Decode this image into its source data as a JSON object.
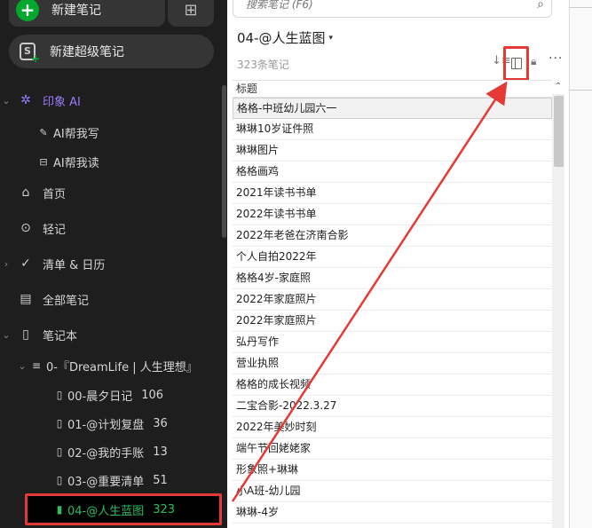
{
  "sidebar": {
    "new_note_label": "新建笔记",
    "new_super_label": "新建超级笔记",
    "ai_label": "印象 AI",
    "ai_write": "AI帮我写",
    "ai_read": "AI帮我读",
    "home": "首页",
    "quick_note": "轻记",
    "tasks": "清单 & 日历",
    "all_notes": "全部笔记",
    "notebooks": "笔记本",
    "stack": "0-『DreamLife | 人生理想』",
    "notebooks_list": [
      {
        "name": "00-晨夕日记",
        "count": "106"
      },
      {
        "name": "01-@计划复盘",
        "count": "36"
      },
      {
        "name": "02-@我的手账",
        "count": "13"
      },
      {
        "name": "03-@重要清单",
        "count": "51"
      },
      {
        "name": "04-@人生蓝图",
        "count": "323"
      }
    ]
  },
  "main": {
    "search_placeholder": "搜索笔记 (F6)",
    "notebook_title": "04-@人生蓝图",
    "note_count": "323条笔记",
    "column_title": "标题",
    "notes": [
      "格格-中班幼儿园六一",
      "琳琳10岁证件照",
      "琳琳图片",
      "格格画鸡",
      "2021年读书书单",
      "2022年读书书单",
      "2022年老爸在济南合影",
      "个人自拍2022年",
      "格格4岁-家庭照",
      "2022年家庭照片",
      "2022年家庭照片",
      "弘丹写作",
      "营业执照",
      "格格的成长视频",
      "二宝合影-2022.3.27",
      "2022年美妙时刻",
      "端午节回姥姥家",
      "形象照+琳琳",
      "小A班-幼儿园",
      "琳琳-4岁"
    ]
  },
  "colors": {
    "sidebar_bg": "#1e1e1e",
    "accent_green": "#00a82d",
    "ai_purple": "#9a7bff",
    "highlight_red": "#e53935"
  }
}
